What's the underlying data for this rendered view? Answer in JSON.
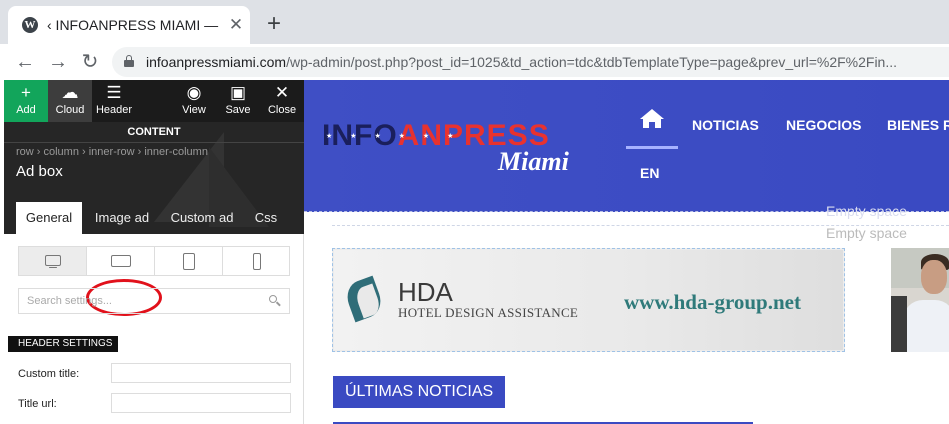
{
  "browser": {
    "tab_title": "‹ INFOANPRESS MIAMI —",
    "tab_favicon": "W",
    "tab_close": "✕",
    "new_tab": "+",
    "url_host": "infoanpressmiami.com",
    "url_path": "/wp-admin/post.php?post_id=1025&td_action=tdc&tdbTemplateType=page&prev_url=%2F%2Fin...",
    "back": "←",
    "forward": "→",
    "reload": "↻"
  },
  "builder": {
    "toolbar": {
      "add": "Add",
      "cloud": "Cloud",
      "header": "Header",
      "view": "View",
      "save": "Save",
      "close": "Close"
    },
    "section_label": "CONTENT",
    "breadcrumb": "row › column › inner-row › inner-column",
    "element_title": "Ad box",
    "tabs": [
      "General",
      "Image ad",
      "Custom ad",
      "Css"
    ],
    "active_tab": "General",
    "highlighted_tab": "Image ad",
    "devices": [
      "desktop-icon",
      "tablet-landscape-icon",
      "tablet-portrait-icon",
      "phone-icon"
    ],
    "search_placeholder": "Search settings...",
    "header_settings_label": "HEADER SETTINGS",
    "fields": [
      {
        "label": "Custom title:",
        "value": ""
      },
      {
        "label": "Title url:",
        "value": ""
      }
    ],
    "highlight_color": "#e1111b"
  },
  "site": {
    "logo_main_dark": "INFO",
    "logo_main_red": "ANPRESS",
    "logo_stars": "★ ★ ★ ★ ★ ★",
    "logo_sub": "Miami",
    "nav": [
      "NOTICIAS",
      "NEGOCIOS",
      "BIENES R"
    ],
    "language": "EN",
    "empty_space_1": "Empty space",
    "empty_space_2": "Empty space",
    "ad": {
      "brand": "HDA",
      "brand_sub": "HOTEL DESIGN ASSISTANCE",
      "website": "www.hda-group.net"
    },
    "section_title": "ÚLTIMAS NOTICIAS",
    "brand_color": "#3a4ac2"
  }
}
